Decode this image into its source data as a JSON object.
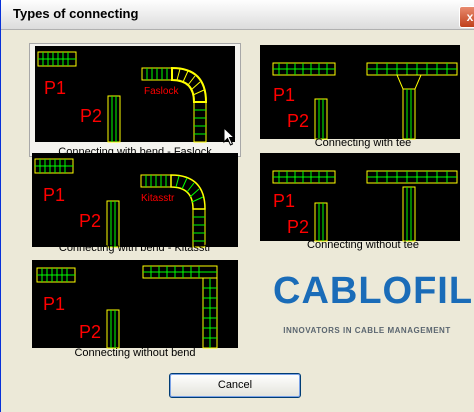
{
  "window": {
    "title": "Types of connecting",
    "close_glyph": "x"
  },
  "options": [
    {
      "caption": "Connecting with bend - Faslock",
      "label_p1": "P1",
      "label_p2": "P2",
      "name_label": "Faslock",
      "selected": true
    },
    {
      "caption": "Connecting with tee",
      "label_p1": "P1",
      "label_p2": "P2"
    },
    {
      "caption": "Connecting with bend - Kitasstr",
      "label_p1": "P1",
      "label_p2": "P2",
      "name_label": "Kitasstr"
    },
    {
      "caption": "Connecting without tee",
      "label_p1": "P1",
      "label_p2": "P2"
    },
    {
      "caption": "Connecting without bend",
      "label_p1": "P1",
      "label_p2": "P2"
    }
  ],
  "logo": {
    "text": "CABLOFIL",
    "tagline": "INNOVATORS IN CABLE MANAGEMENT"
  },
  "buttons": {
    "cancel": "Cancel"
  },
  "colors": {
    "preview_bg": "#000000",
    "tray": "#ffff00",
    "rung": "#00ff00",
    "label": "#ff0000",
    "logo": "#1a6cb8"
  }
}
